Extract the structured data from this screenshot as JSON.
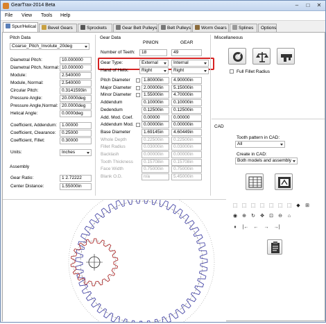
{
  "window": {
    "title": "GearTrax-2014 Beta",
    "minimize": "–",
    "maximize": "□",
    "close": "✕"
  },
  "menu": [
    "File",
    "View",
    "Tools",
    "Help"
  ],
  "tabs": [
    {
      "label": "Spur/Helical",
      "color": "#5a7fb8"
    },
    {
      "label": "Bevel Gears",
      "color": "#c8a040"
    },
    {
      "label": "Sprockets",
      "color": "#555555"
    },
    {
      "label": "Gear Belt Pulleys",
      "color": "#777777"
    },
    {
      "label": "Belt Pulleys",
      "color": "#777777"
    },
    {
      "label": "Worm Gears",
      "color": "#8a6a3a"
    },
    {
      "label": "Splines",
      "color": "#999999"
    },
    {
      "label": "Options",
      "color": ""
    }
  ],
  "pitch_data": {
    "title": "Pitch Data",
    "standard": "Coarse_Pitch_Involute_20deg",
    "rows": [
      {
        "label": "Diametral Pitch:",
        "value": "10.000000"
      },
      {
        "label": "Diametral Pitch, Normal:",
        "value": "10.000000"
      },
      {
        "label": "Module:",
        "value": "2.540000"
      },
      {
        "label": "Module, Normal:",
        "value": "2.540000"
      },
      {
        "label": "Circular Pitch:",
        "value": "0.3141593in"
      },
      {
        "label": "Pressure Angle:",
        "value": "20.0000deg"
      },
      {
        "label": "Pressure Angle,Normal:",
        "value": "20.0000deg"
      },
      {
        "label": "Helical Angle:",
        "value": "0.0000deg"
      }
    ],
    "coef_rows": [
      {
        "label": "Coefficient, Addendum:",
        "value": "1.00000"
      },
      {
        "label": "Coefficient, Clearance:",
        "value": "0.25000"
      },
      {
        "label": "Coefficient, Fillet:",
        "value": "0.30000"
      }
    ],
    "units_label": "Units:",
    "units_value": "Inches"
  },
  "assembly": {
    "title": "Assembly",
    "rows": [
      {
        "label": "Gear Ratio:",
        "value": "1 2.72222"
      },
      {
        "label": "Center Distance:",
        "value": "1.55000in"
      }
    ]
  },
  "gear_data": {
    "title": "Gear Data",
    "col_pinion": "PINION",
    "col_gear": "GEAR",
    "teeth_label": "Number of Teeth:",
    "teeth_pinion": "18",
    "teeth_gear": "49",
    "type_label": "Gear Type:",
    "type_pinion": "External",
    "type_gear": "Internal",
    "hand_label": "Hand of Helix:",
    "hand_pinion": "Right",
    "hand_gear": "Right",
    "rows": [
      {
        "label": "Pitch Diameter",
        "p": "1.80000in",
        "g": "4.90000in",
        "chk": true,
        "dis": false
      },
      {
        "label": "Major Diameter",
        "p": "2.00000in",
        "g": "5.15000in",
        "chk": true,
        "dis": false
      },
      {
        "label": "Minor Diameter",
        "p": "1.55000in",
        "g": "4.70000in",
        "chk": true,
        "dis": false
      },
      {
        "label": "Addendum",
        "p": "0.10000in",
        "g": "0.10000in",
        "chk": false,
        "dis": false
      },
      {
        "label": "Dedendum",
        "p": "0.12500in",
        "g": "0.12500in",
        "chk": false,
        "dis": false
      },
      {
        "label": "Add. Mod. Coef.",
        "p": "0.00000",
        "g": "0.00000",
        "chk": false,
        "dis": false
      },
      {
        "label": "Addendum Mod.",
        "p": "0.00000in",
        "g": "0.00000in",
        "chk": true,
        "dis": false
      },
      {
        "label": "Base Diameter",
        "p": "1.69145in",
        "g": "4.60449in",
        "chk": false,
        "dis": false
      },
      {
        "label": "Whole Depth",
        "p": "0.22500in",
        "g": "0.22500in",
        "chk": false,
        "dis": true
      },
      {
        "label": "Fillet Radius",
        "p": "0.03000in",
        "g": "0.03000in",
        "chk": false,
        "dis": true
      },
      {
        "label": "Backlash",
        "p": "0.00000in",
        "g": "0.00000in",
        "chk": false,
        "dis": true
      },
      {
        "label": "Tooth Thickness",
        "p": "0.15708in",
        "g": "0.15708in",
        "chk": false,
        "dis": true
      },
      {
        "label": "Face Width",
        "p": "0.75000in",
        "g": "0.75000in",
        "chk": false,
        "dis": true
      },
      {
        "label": "Blank O.D.",
        "p": "n/a",
        "g": "5.45000in",
        "chk": false,
        "dis": true
      }
    ]
  },
  "misc": {
    "title": "Miscellaneous",
    "full_fillet_label": "Full Fillet Radius"
  },
  "cad": {
    "title": "CAD",
    "tooth_pattern_label": "Tooth pattern in CAD:",
    "tooth_pattern_value": "All",
    "create_label": "Create in CAD:",
    "create_value": "Both models and assembly"
  },
  "toolbox_row3": [
    "⏸",
    "|←",
    "←",
    "→",
    "→|"
  ],
  "colors": {
    "pinion": "#b03030",
    "gear": "#4a4aa8",
    "accent": "#d62222"
  }
}
